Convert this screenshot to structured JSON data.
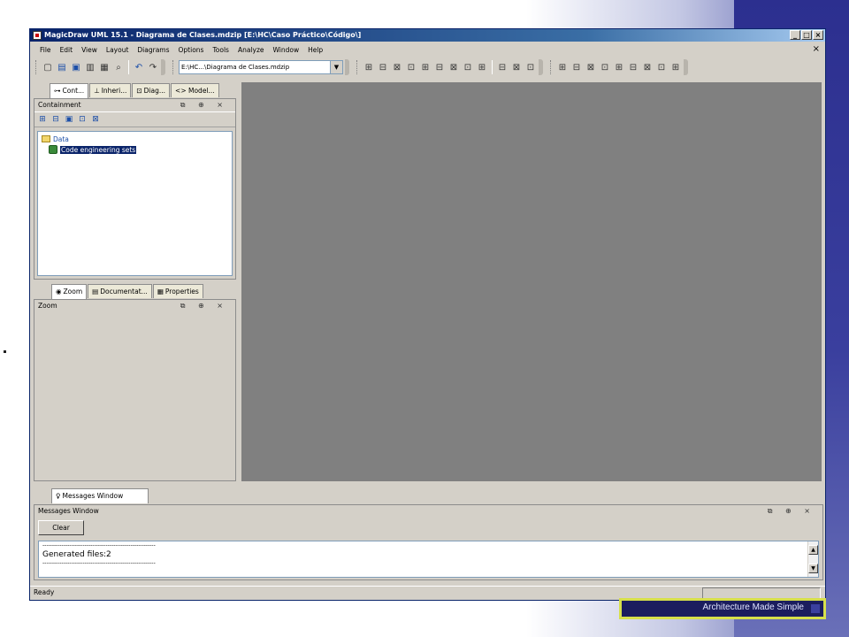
{
  "window": {
    "title": "MagicDraw UML 15.1 - Diagrama de Clases.mdzip [E:\\HC\\Caso Práctico\\Código\\]",
    "controls": [
      "_",
      "□",
      "×"
    ]
  },
  "menubar": {
    "items": [
      "File",
      "Edit",
      "View",
      "Layout",
      "Diagrams",
      "Options",
      "Tools",
      "Analyze",
      "Window",
      "Help"
    ],
    "close_glyph": "×"
  },
  "toolbar": {
    "project_path": "E:\\HC...\\Diagrama de Clases.mdzip",
    "combo_arrow": "▼",
    "icons": [
      "new-icon",
      "open-icon",
      "save-icon",
      "print-icon",
      "print-preview-icon",
      "find-icon",
      "undo-icon",
      "redo-icon"
    ]
  },
  "browser": {
    "tabs": [
      "Cont...",
      "Inheri...",
      "Diag...",
      "<> Model..."
    ],
    "panel_title": "Containment",
    "panel_ctrls": "⧉ ⊕ ×",
    "tree": [
      {
        "label": "Data",
        "type": "folder"
      },
      {
        "label": "Code engineering sets",
        "type": "code-set",
        "selected": true
      }
    ]
  },
  "zoom_panel": {
    "tabs": [
      "Zoom",
      "Documentat...",
      "Properties"
    ],
    "panel_title": "Zoom",
    "panel_ctrls": "⧉ ⊕ ×"
  },
  "messages": {
    "tab": "Messages Window",
    "panel_title": "Messages Window",
    "panel_ctrls": "⧉ ⊕ ×",
    "clear_label": "Clear",
    "lines": [
      "-----------------------------------------------------------",
      "Generated files:2",
      "-----------------------------------------------------------"
    ]
  },
  "status": {
    "text": "Ready"
  },
  "slide": {
    "footer_text": "Architecture Made Simple"
  },
  "colors": {
    "title_start": "#0a246a",
    "title_end": "#a6caf0",
    "canvas": "#808080",
    "chrome": "#d4d0c8",
    "footer_border": "#d7e04a"
  }
}
